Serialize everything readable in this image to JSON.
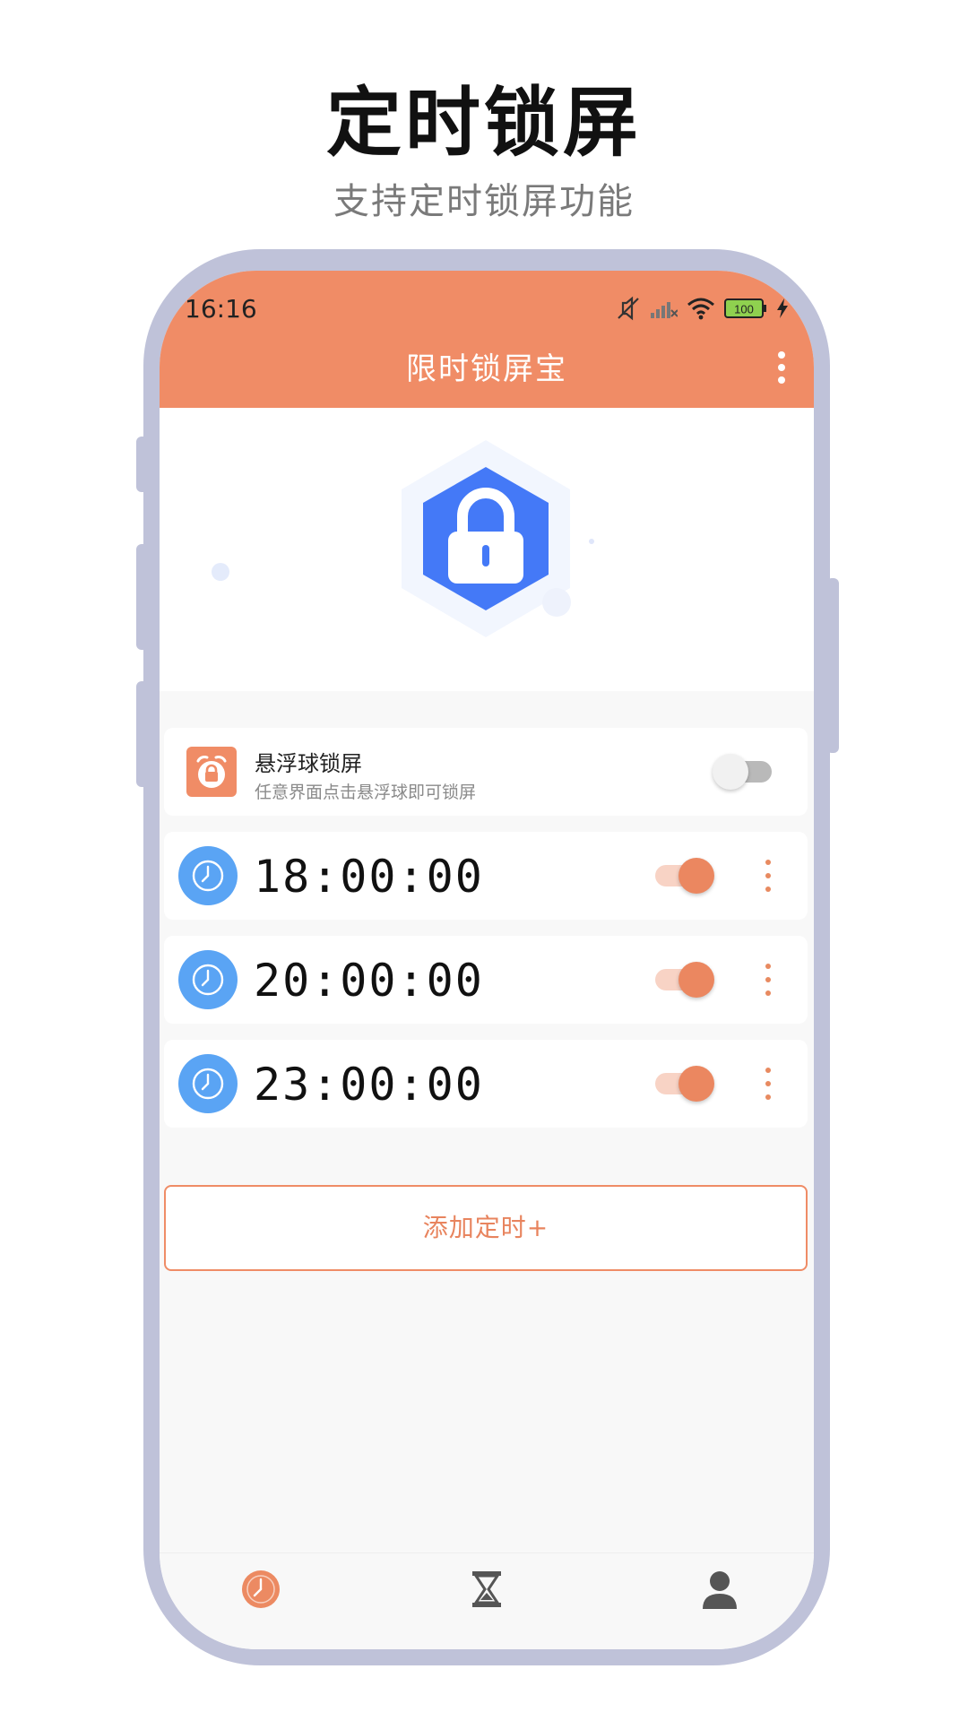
{
  "promo": {
    "title": "定时锁屏",
    "subtitle": "支持定时锁屏功能"
  },
  "status_bar": {
    "time": "16:16",
    "battery": "100"
  },
  "app": {
    "title": "限时锁屏宝"
  },
  "floating_lock": {
    "title": "悬浮球锁屏",
    "description": "任意界面点击悬浮球即可锁屏",
    "enabled": false
  },
  "timers": [
    {
      "time": "18:00:00",
      "enabled": true
    },
    {
      "time": "20:00:00",
      "enabled": true
    },
    {
      "time": "23:00:00",
      "enabled": true
    }
  ],
  "add_timer": {
    "label": "添加定时+"
  },
  "bottom_nav": [
    {
      "icon": "clock-icon",
      "active": true
    },
    {
      "icon": "hourglass-icon",
      "active": false
    },
    {
      "icon": "user-icon",
      "active": false
    }
  ],
  "colors": {
    "accent": "#f08c66",
    "lock_blue": "#4479f7",
    "clock_blue": "#5aa4f4",
    "frame": "#bfc2d9"
  }
}
